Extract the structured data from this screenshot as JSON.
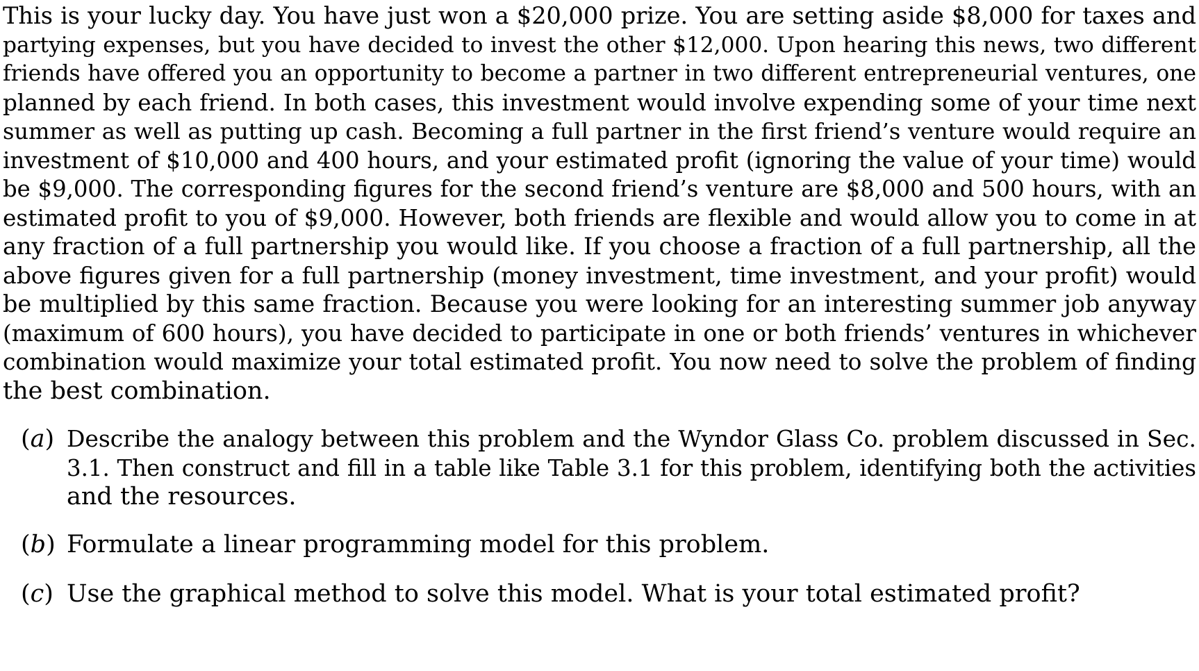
{
  "paragraph": {
    "lines": [
      "This is your lucky day. You have just won a $20,000 prize. You are setting aside $8,000 for taxes and",
      "partying expenses, but you have decided to invest the other $12,000. Upon hearing this news, two different",
      "friends have offered you an opportunity to become a partner in two different entrepreneurial ventures, one",
      "planned by each friend. In both cases, this investment would involve expending some of your time next",
      "summer as well as putting up cash. Becoming a full partner in the first friend’s venture would require an",
      "investment of $10,000 and 400 hours, and your estimated profit (ignoring the value of your time) would",
      "be $9,000. The corresponding figures for the second friend’s venture are $8,000 and 500 hours, with an",
      "estimated profit to you of $9,000. However, both friends are flexible and would allow you to come in at",
      "any fraction of a full partnership you would like. If you choose a fraction of a full partnership, all the",
      "above figures given for a full partnership (money investment, time investment, and your profit) would",
      "be multiplied by this same fraction. Because you were looking for an interesting summer job anyway",
      "(maximum of 600 hours), you have decided to participate in one or both friends’ ventures in whichever",
      "combination would maximize your total estimated profit. You now need to solve the problem of finding",
      "the best combination."
    ]
  },
  "questions": [
    {
      "open": "(",
      "letter": "a",
      "close": ")",
      "lines": [
        "Describe the analogy between this problem and the Wyndor Glass Co. problem discussed in Sec.",
        "3.1. Then construct and fill in a table like Table 3.1 for this problem, identifying both the activities",
        "and the resources."
      ]
    },
    {
      "open": "(",
      "letter": "b",
      "close": ")",
      "lines": [
        "Formulate a linear programming model for this problem."
      ]
    },
    {
      "open": "(",
      "letter": "c",
      "close": ")",
      "lines": [
        "Use the graphical method to solve this model. What is your total estimated profit?"
      ]
    }
  ]
}
